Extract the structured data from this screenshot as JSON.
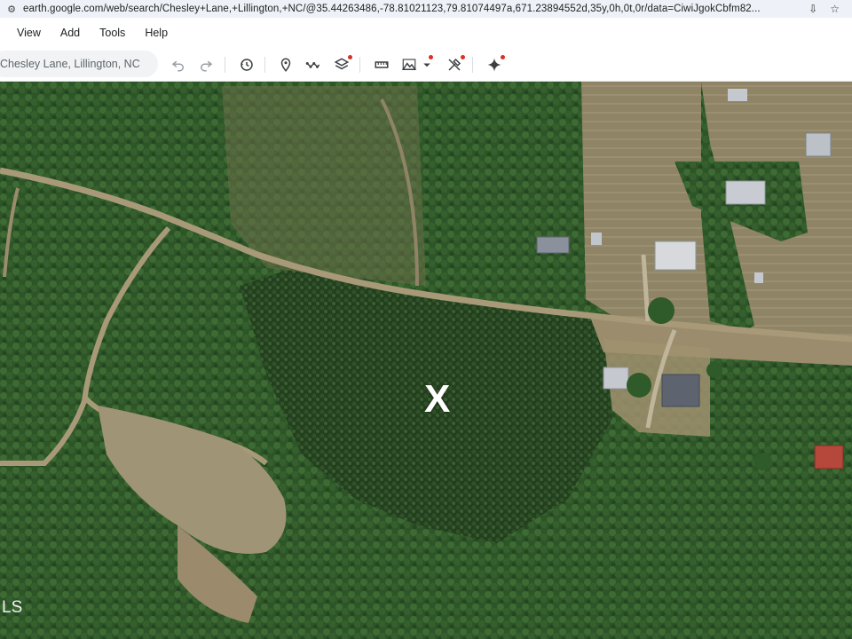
{
  "browser": {
    "url": "earth.google.com/web/search/Chesley+Lane,+Lillington,+NC/@35.44263486,-78.81021123,79.81074497a,671.23894552d,35y,0h,0t,0r/data=CiwiJgokCbfm82..."
  },
  "menu": {
    "items": [
      {
        "label": "View"
      },
      {
        "label": "Add"
      },
      {
        "label": "Tools"
      },
      {
        "label": "Help"
      }
    ]
  },
  "toolbar": {
    "search_value": "Chesley Lane, Lillington, NC"
  },
  "map": {
    "marker_label": "X",
    "corner_label": "LS"
  },
  "colors": {
    "accent_dot": "#d93025",
    "icon": "#3c4043"
  }
}
